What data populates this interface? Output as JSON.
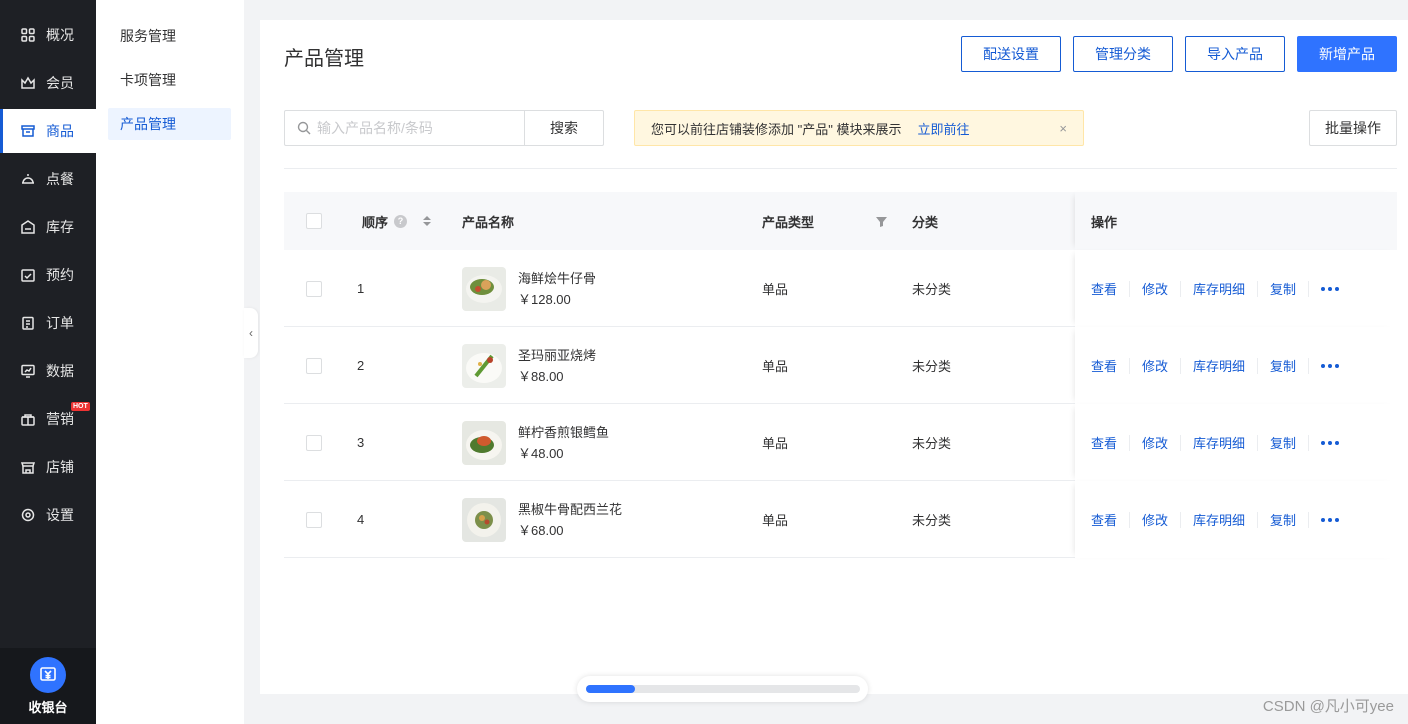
{
  "nav": {
    "items": [
      {
        "label": "概况",
        "icon": "grid-icon"
      },
      {
        "label": "会员",
        "icon": "crown-icon"
      },
      {
        "label": "商品",
        "icon": "store-icon",
        "active": true
      },
      {
        "label": "点餐",
        "icon": "dish-cover-icon"
      },
      {
        "label": "库存",
        "icon": "warehouse-icon"
      },
      {
        "label": "预约",
        "icon": "calendar-check-icon"
      },
      {
        "label": "订单",
        "icon": "clipboard-icon"
      },
      {
        "label": "数据",
        "icon": "chart-monitor-icon"
      },
      {
        "label": "营销",
        "icon": "gift-icon",
        "badge": "HOT"
      },
      {
        "label": "店铺",
        "icon": "shop-icon"
      },
      {
        "label": "设置",
        "icon": "settings-icon"
      }
    ],
    "cashier_label": "收银台"
  },
  "subnav": {
    "items": [
      {
        "label": "服务管理"
      },
      {
        "label": "卡项管理"
      },
      {
        "label": "产品管理",
        "active": true
      }
    ]
  },
  "page": {
    "title": "产品管理",
    "buttons": {
      "delivery": "配送设置",
      "categories": "管理分类",
      "import": "导入产品",
      "add": "新增产品"
    },
    "search": {
      "placeholder": "输入产品名称/条码",
      "value": "",
      "button": "搜索"
    },
    "notice": {
      "text": "您可以前往店铺装修添加 \"产品\" 模块来展示",
      "link": "立即前往",
      "close": "×"
    },
    "batch": "批量操作"
  },
  "table": {
    "headers": {
      "order": "顺序",
      "help": "?",
      "name": "产品名称",
      "type": "产品类型",
      "category": "分类",
      "ops": "操作"
    },
    "rows": [
      {
        "order": "1",
        "name": "海鲜烩牛仔骨",
        "price": "￥128.00",
        "type": "单品",
        "category": "未分类"
      },
      {
        "order": "2",
        "name": "圣玛丽亚烧烤",
        "price": "￥88.00",
        "type": "单品",
        "category": "未分类"
      },
      {
        "order": "3",
        "name": "鲜柠香煎银鳕鱼",
        "price": "￥48.00",
        "type": "单品",
        "category": "未分类"
      },
      {
        "order": "4",
        "name": "黑椒牛骨配西兰花",
        "price": "￥68.00",
        "type": "单品",
        "category": "未分类"
      }
    ],
    "ops": {
      "view": "查看",
      "edit": "修改",
      "stock": "库存明细",
      "copy": "复制"
    }
  },
  "scroll": {
    "position_fraction": 0.18
  },
  "watermark": "CSDN @凡小可yee",
  "colors": {
    "accent": "#155bd4",
    "primary_button": "#2f73ff",
    "sidebar": "#1e2025",
    "notice_bg": "#fff7e0",
    "hot_badge": "#ee3333"
  }
}
